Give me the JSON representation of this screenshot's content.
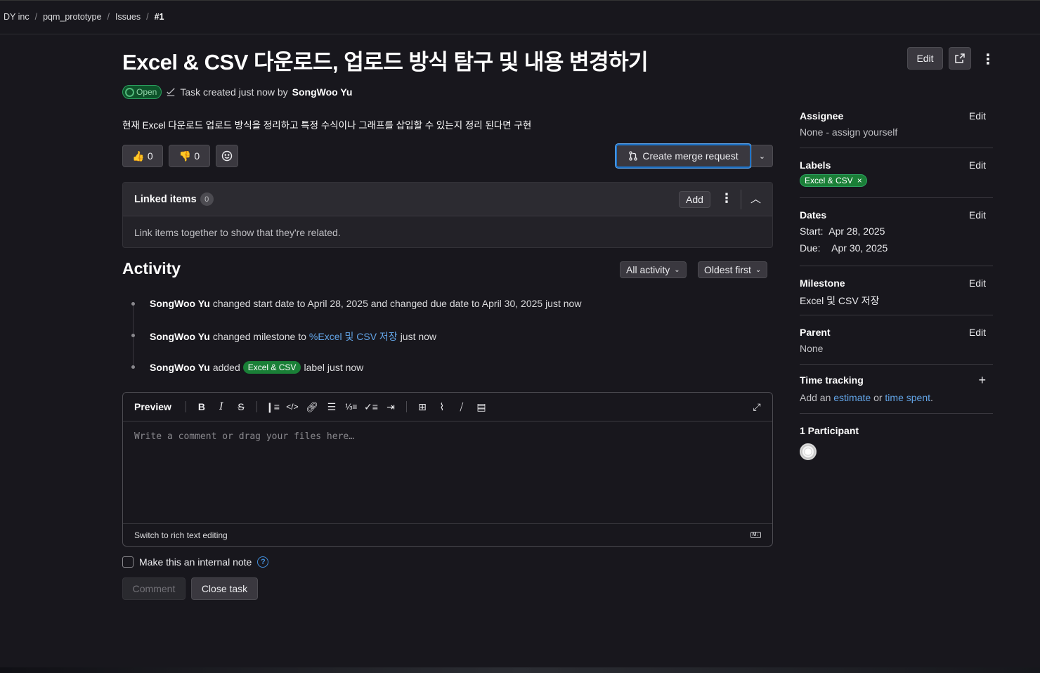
{
  "breadcrumb": [
    "DY inc",
    "pqm_prototype",
    "Issues",
    "#1"
  ],
  "issue": {
    "title": "Excel & CSV 다운로드, 업로드 방식 탐구 및 내용 변경하기",
    "status": "Open",
    "meta_prefix": "Task created just now by",
    "author": "SongWoo Yu",
    "description": "현재 Excel 다운로드 업로드 방식을 정리하고 특정 수식이나 그래프를 삽입할 수 있는지 정리 된다면 구현",
    "edit_label": "Edit"
  },
  "reactions": {
    "thumbs_up": "0",
    "thumbs_down": "0"
  },
  "merge_request_label": "Create merge request",
  "linked_items": {
    "title": "Linked items",
    "count": "0",
    "add_label": "Add",
    "empty_text": "Link items together to show that they're related."
  },
  "activity": {
    "title": "Activity",
    "filter": "All activity",
    "sort": "Oldest first",
    "notes": [
      {
        "author": "SongWoo Yu",
        "text": "changed start date to April 28, 2025 and changed due date to April 30, 2025 just now"
      },
      {
        "author": "SongWoo Yu",
        "text_before": "changed milestone to",
        "link": "%Excel 및 CSV 저장",
        "text_after": "just now"
      },
      {
        "author": "SongWoo Yu",
        "text_before": "added",
        "label": "Excel & CSV",
        "text_after": "label just now"
      }
    ]
  },
  "editor": {
    "preview_label": "Preview",
    "placeholder": "Write a comment or drag your files here…",
    "switch_label": "Switch to rich text editing",
    "md_badge": "M↓"
  },
  "internal_note_label": "Make this an internal note",
  "comment_label": "Comment",
  "close_label": "Close task",
  "sidebar": {
    "edit": "Edit",
    "assignee": {
      "title": "Assignee",
      "value": "None - assign yourself"
    },
    "labels": {
      "title": "Labels",
      "label": "Excel & CSV"
    },
    "dates": {
      "title": "Dates",
      "start_label": "Start:",
      "start": "Apr 28, 2025",
      "due_label": "Due:",
      "due": "Apr 30, 2025"
    },
    "milestone": {
      "title": "Milestone",
      "value": "Excel 및 CSV 저장"
    },
    "parent": {
      "title": "Parent",
      "value": "None"
    },
    "time": {
      "title": "Time tracking",
      "prefix": "Add an",
      "estimate": "estimate",
      "or": "or",
      "spent": "time spent",
      "suffix": "."
    },
    "participants": {
      "title": "1 Participant"
    }
  },
  "colors": {
    "background": "#18171d",
    "accent": "#1f75cb",
    "success": "#1a7f37",
    "link": "#63a6e9"
  }
}
